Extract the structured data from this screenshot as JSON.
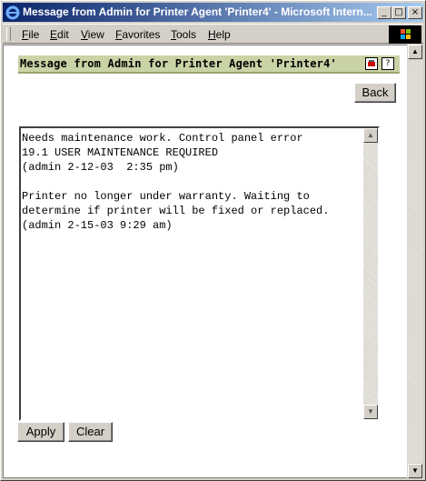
{
  "window": {
    "title": "Message from Admin for Printer Agent 'Printer4' - Microsoft Intern...",
    "controls": {
      "minimize": "_",
      "maximize": "□",
      "close": "×"
    }
  },
  "menu": [
    {
      "key": "F",
      "rest": "ile"
    },
    {
      "key": "E",
      "rest": "dit"
    },
    {
      "key": "V",
      "rest": "iew"
    },
    {
      "key": "F",
      "rest": "avorites"
    },
    {
      "key": "T",
      "rest": "ools"
    },
    {
      "key": "H",
      "rest": "elp"
    }
  ],
  "page": {
    "heading": "Message from Admin for Printer Agent 'Printer4'",
    "help_icon": "?",
    "back_label": "Back",
    "message": "Needs maintenance work. Control panel error\n19.1 USER MAINTENANCE REQUIRED\n(admin 2-12-03  2:35 pm)\n\nPrinter no longer under warranty. Waiting to\ndetermine if printer will be fixed or replaced.\n(admin 2-15-03 9:29 am)",
    "apply_label": "Apply",
    "clear_label": "Clear"
  },
  "colors": {
    "title_gradient_start": "#0a246a",
    "title_gradient_end": "#a6caf0",
    "heading_bar": "#c9d3a6",
    "chrome": "#d4d0c8"
  }
}
